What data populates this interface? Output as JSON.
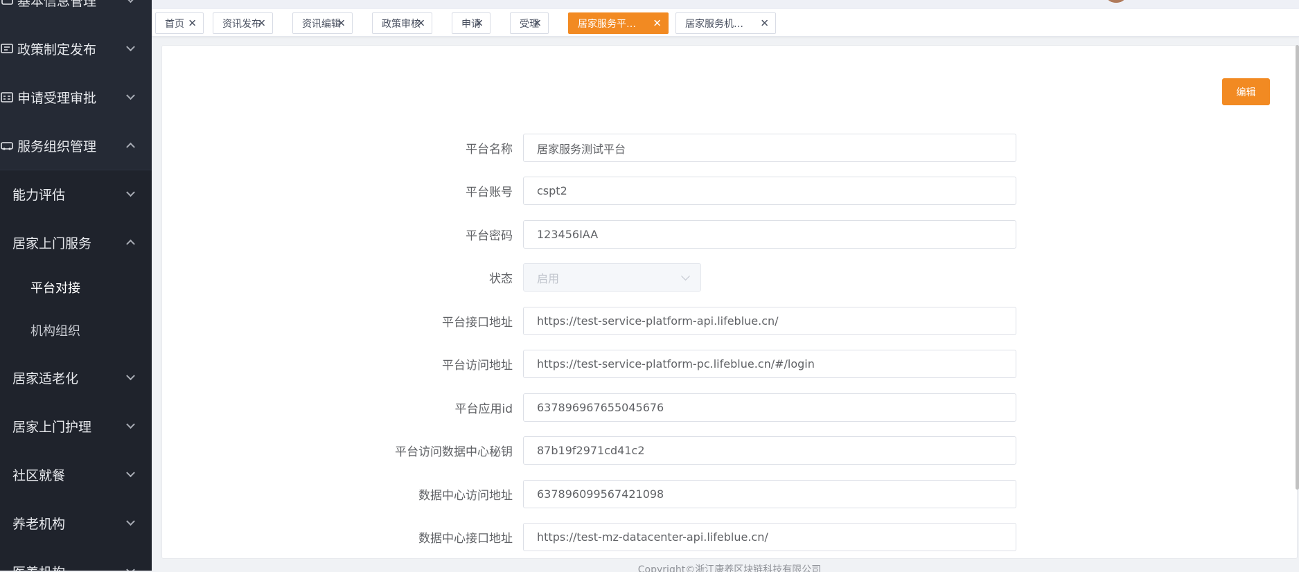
{
  "sidebar": {
    "top_items": [
      {
        "label": "基本信息管理",
        "icon": "info-icon"
      },
      {
        "label": "政策制定发布",
        "icon": "policy-icon"
      },
      {
        "label": "申请受理审批",
        "icon": "approval-icon"
      },
      {
        "label": "服务组织管理",
        "icon": "org-icon"
      }
    ],
    "sub_items": {
      "capability": "能力评估",
      "home_visit": "居家上门服务",
      "platform_dock": "平台对接",
      "org": "机构组织",
      "aging_adapt": "居家适老化",
      "home_nursing": "居家上门护理",
      "community_meal": "社区就餐",
      "elder_inst": "养老机构",
      "medical_inst": "医养机构"
    }
  },
  "tabs": [
    {
      "label": "首页"
    },
    {
      "label": "资讯发布"
    },
    {
      "label": "资讯编辑"
    },
    {
      "label": "政策审核"
    },
    {
      "label": "申请"
    },
    {
      "label": "受理"
    },
    {
      "label": "居家服务平…",
      "active": true
    },
    {
      "label": "居家服务机…"
    }
  ],
  "edit_button": "编辑",
  "form": {
    "platform_name": {
      "label": "平台名称",
      "value": "居家服务测试平台"
    },
    "platform_account": {
      "label": "平台账号",
      "value": "cspt2"
    },
    "platform_password": {
      "label": "平台密码",
      "value": "123456IAA"
    },
    "status": {
      "label": "状态",
      "value": "启用"
    },
    "api_address": {
      "label": "平台接口地址",
      "value": "https://test-service-platform-api.lifeblue.cn/"
    },
    "access_address": {
      "label": "平台访问地址",
      "value": "https://test-service-platform-pc.lifeblue.cn/#/login"
    },
    "app_id": {
      "label": "平台应用id",
      "value": "637896967655045676"
    },
    "datacenter_secret": {
      "label": "平台访问数据中心秘钥",
      "value": "87b19f2971cd41c2"
    },
    "datacenter_access": {
      "label": "数据中心访问地址",
      "value": "637896099567421098"
    },
    "datacenter_api": {
      "label": "数据中心接口地址",
      "value": "https://test-mz-datacenter-api.lifeblue.cn/"
    }
  },
  "footer": "Copyright©浙江康养区块链科技有限公司",
  "colors": {
    "accent": "#f28a22",
    "sidebar_bg": "#2c3240"
  }
}
